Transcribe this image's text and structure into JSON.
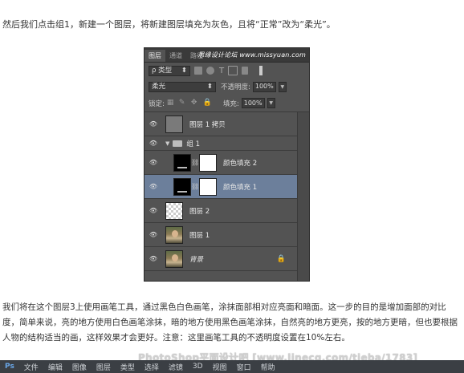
{
  "intro_text": "然后我们点击组1，新建一个图层，将新建图层填充为灰色，且将“正常”改为“柔光”。",
  "panel": {
    "tabs": [
      "图层",
      "通道",
      "路径"
    ],
    "watermark_top": "思缘设计论坛 www.missyuan.com",
    "filter_label": "ρ 类型",
    "blend_mode": "柔光",
    "opacity_label": "不透明度:",
    "opacity_value": "100%",
    "lock_label": "锁定:",
    "fill_label": "填充:",
    "fill_value": "100%",
    "layers": [
      {
        "name": "图层 1 拷贝",
        "thumb": "gray"
      },
      {
        "name": "组 1",
        "type": "group"
      },
      {
        "name": "颜色填充 2",
        "thumb": "black-mask"
      },
      {
        "name": "颜色填充 1",
        "thumb": "black-mask",
        "selected": true
      },
      {
        "name": "图层 2",
        "thumb": "checker"
      },
      {
        "name": "图层 1",
        "thumb": "photo"
      },
      {
        "name": "背景",
        "thumb": "photo",
        "locked": true
      }
    ]
  },
  "outro_text": "我们将在这个图层3上使用画笔工具，通过黑色白色画笔，涂抹面部相对应亮面和暗面。这一步的目的是增加面部的对比度，简单来说，亮的地方使用白色画笔涂抹，暗的地方使用黑色画笔涂抹，自然亮的地方更亮，按的地方更暗，但也要根据人物的结构适当的画，这样效果才会更好。注意：这里画笔工具的不透明度设置在10%左右。",
  "watermark_bottom": "PhotoShop平面设计吧 [www.linecg.com/tieba/1783]",
  "bottom_menu": [
    "文件",
    "编辑",
    "图像",
    "图层",
    "类型",
    "选择",
    "滤镜",
    "3D",
    "视图",
    "窗口",
    "帮助"
  ],
  "colors": {
    "panel_bg": "#535353",
    "selected": "#6c7f9b"
  }
}
